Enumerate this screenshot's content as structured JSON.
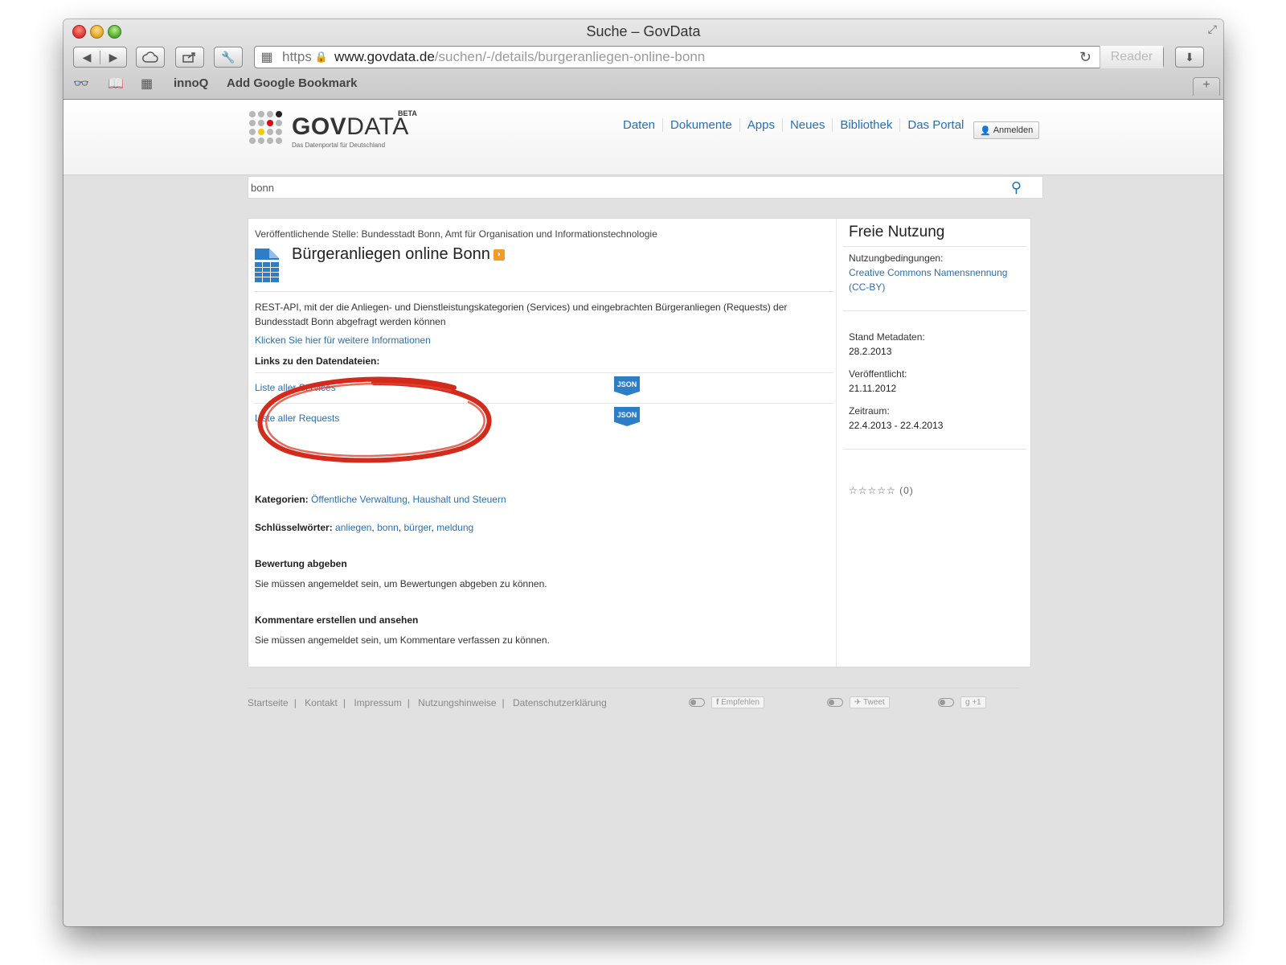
{
  "window": {
    "title": "Suche – GovData"
  },
  "toolbar": {
    "url_https": "https",
    "url_domain": "www.govdata.de",
    "url_path": "/suchen/-/details/burgeranliegen-online-bonn",
    "reader_label": "Reader"
  },
  "bookmarks": {
    "items": [
      "innoQ",
      "Add Google Bookmark"
    ]
  },
  "site": {
    "logo_bold": "GOV",
    "logo_rest": "DATA",
    "logo_beta": "BETA",
    "logo_tagline": "Das Datenportal für Deutschland",
    "nav": [
      "Daten",
      "Dokumente",
      "Apps",
      "Neues",
      "Bibliothek",
      "Das Portal"
    ],
    "login_label": "Anmelden"
  },
  "search": {
    "value": "bonn"
  },
  "dataset": {
    "publisher": "Veröffentlichende Stelle: Bundesstadt Bonn, Amt für Organisation und Informationstechnologie",
    "title": "Bürgeranliegen online Bonn",
    "description": "REST-API, mit der die Anliegen- und Dienstleistungskategorien (Services) und eingebrachten Bürgeranliegen (Requests) der Bundesstadt Bonn abgefragt werden können",
    "more_link": "Klicken Sie hier für weitere Informationen",
    "links_heading": "Links zu den Datendateien:",
    "files": [
      {
        "name": "Liste aller Services",
        "format": "JSON"
      },
      {
        "name": "Liste aller Requests",
        "format": "JSON"
      }
    ],
    "categories_label": "Kategorien:",
    "categories_value": "Öffentliche Verwaltung, Haushalt und Steuern",
    "keywords_label": "Schlüsselwörter:",
    "keywords": [
      "anliegen",
      "bonn",
      "bürger",
      "meldung"
    ],
    "rating_heading": "Bewertung abgeben",
    "rating_text": "Sie müssen angemeldet sein, um Bewertungen abgeben zu können.",
    "comments_heading": "Kommentare erstellen und ansehen",
    "comments_text": "Sie müssen angemeldet sein, um Kommentare verfassen zu können."
  },
  "sidebar": {
    "license_title": "Freie Nutzung",
    "terms_label": "Nutzungbedingungen:",
    "license_link": "Creative Commons Namensnennung (CC-BY)",
    "meta_label": "Stand Metadaten:",
    "meta_value": "28.2.2013",
    "published_label": "Veröffentlicht:",
    "published_value": "21.11.2012",
    "period_label": "Zeitraum:",
    "period_value": "22.4.2013 - 22.4.2013",
    "rating_count": "(0)"
  },
  "footer": {
    "links": [
      "Startseite",
      "Kontakt",
      "Impressum",
      "Nutzungshinweise",
      "Datenschutzerklärung"
    ],
    "social": [
      "Empfehlen",
      "Tweet",
      "+1"
    ]
  },
  "colors": {
    "link": "#2a6fb1",
    "json_badge": "#2c7fc7",
    "annotation": "#d42a1c"
  }
}
